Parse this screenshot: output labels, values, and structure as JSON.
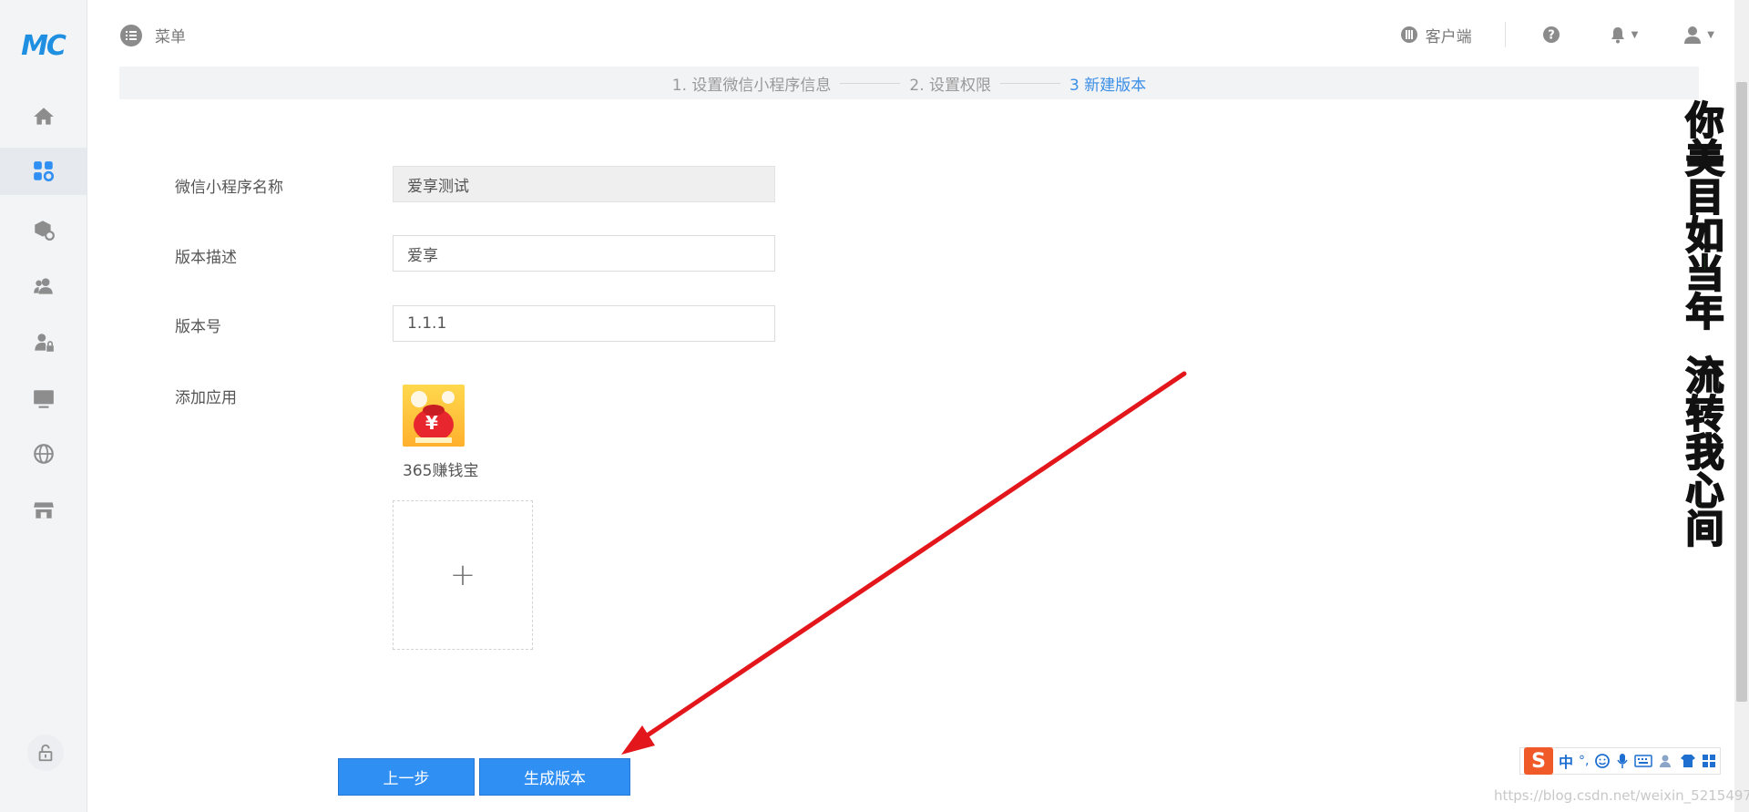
{
  "sidebar": {
    "logo": "MC",
    "items": [
      {
        "icon": "home-icon",
        "active": false
      },
      {
        "icon": "apps-settings-icon",
        "active": true
      },
      {
        "icon": "package-settings-icon",
        "active": false
      },
      {
        "icon": "users-icon",
        "active": false
      },
      {
        "icon": "user-lock-icon",
        "active": false
      },
      {
        "icon": "monitor-icon",
        "active": false
      },
      {
        "icon": "globe-icon",
        "active": false
      },
      {
        "icon": "store-icon",
        "active": false
      }
    ],
    "lock_icon": "lock-icon"
  },
  "header": {
    "menu_label": "菜单",
    "client_label": "客户端",
    "icons": [
      "help-icon",
      "bell-icon",
      "user-icon"
    ]
  },
  "stepper": {
    "steps": [
      {
        "label": "1. 设置微信小程序信息",
        "current": false
      },
      {
        "label": "2. 设置权限",
        "current": false
      },
      {
        "label": "3 新建版本",
        "current": true
      }
    ]
  },
  "form": {
    "name_label": "微信小程序名称",
    "name_value": "爱享测试",
    "desc_label": "版本描述",
    "desc_value": "爱享",
    "version_label": "版本号",
    "version_value": "1.1.1",
    "apps_label": "添加应用",
    "apps": [
      {
        "name": "365赚钱宝",
        "icon": "money-bag-icon",
        "glyph": "¥"
      }
    ],
    "add_glyph": "+"
  },
  "actions": {
    "prev_label": "上一步",
    "generate_label": "生成版本"
  },
  "overlay": {
    "vertical_text_1": "你美目如当年",
    "vertical_text_2": "流转我心间",
    "ime_logo": "S",
    "ime_mode": "中",
    "ime_punct": "°,",
    "watermark": "https://blog.csdn.net/weixin_5215497"
  },
  "colors": {
    "primary": "#2f8ff3",
    "step_active": "#3a8ee6",
    "annotation_arrow": "#e3161b",
    "overlay_text": "#3dd43a"
  }
}
